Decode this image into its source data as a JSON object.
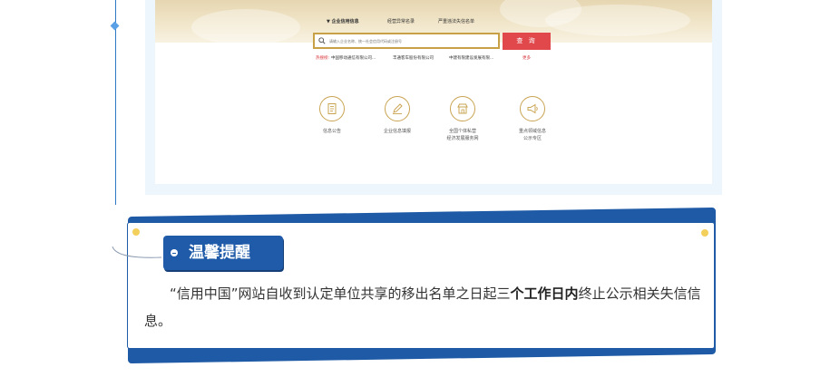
{
  "portal": {
    "tabs": [
      "▼ 企业信用信息",
      "经营异常名录",
      "严重违法失信名单"
    ],
    "search": {
      "placeholder": "请输入企业名称、统一社会信用代码或注册号",
      "button_label": "查 询"
    },
    "hot_search": {
      "label": "热搜榜:",
      "items": [
        "中国移动通信有限公司...",
        "丰通客车股份有限公司",
        "中建有限建设发展有限..."
      ],
      "more_label": "更多"
    },
    "services": [
      {
        "icon": "document-icon",
        "label_lines": [
          "信息公告"
        ]
      },
      {
        "icon": "pen-icon",
        "label_lines": [
          "企业信息填报"
        ]
      },
      {
        "icon": "shop-icon",
        "label_lines": [
          "全国个体私营",
          "经济发展服务网"
        ]
      },
      {
        "icon": "megaphone-icon",
        "label_lines": [
          "重点领域信息",
          "公示专区"
        ]
      }
    ]
  },
  "reminder": {
    "title": "温馨提醒",
    "text_before": "“信用中国”网站自收到认定单位共享的移出名单之日起三",
    "text_bold": "个工作日内",
    "text_after": "终止公示相关失信信息。"
  },
  "colors": {
    "accent_blue": "#1f5ba8",
    "gold": "#c9a452",
    "search_red": "#e0484c",
    "yellow_dot": "#f3cf5c"
  }
}
